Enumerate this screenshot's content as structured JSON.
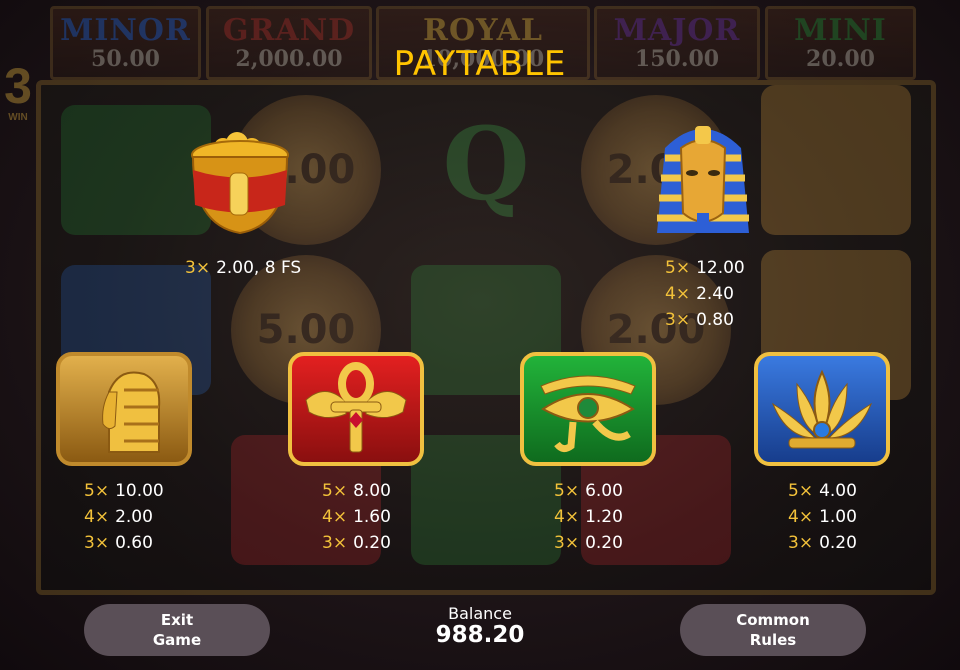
{
  "jackpots": [
    {
      "name": "MINOR",
      "value": "50.00",
      "color": "#2f6fe0"
    },
    {
      "name": "GRAND",
      "value": "2,000.00",
      "color": "#c0392b"
    },
    {
      "name": "ROYAL",
      "value": "10,000.00",
      "color": "#f0c040"
    },
    {
      "name": "MAJOR",
      "value": "150.00",
      "color": "#7a3ab0"
    },
    {
      "name": "MINI",
      "value": "20.00",
      "color": "#2f9a3a"
    }
  ],
  "background": {
    "side_digit": "3",
    "side_label": "WIN",
    "coin_values": [
      "3.00",
      "2.00",
      "5.00",
      "2.00"
    ],
    "letter_symbol": "Q"
  },
  "title": "PAYTABLE",
  "symbols": {
    "pot": {
      "icon": "gold-pot-icon",
      "pays": [
        {
          "mult": "3×",
          "value": "2.00, 8 FS"
        }
      ]
    },
    "pharaoh": {
      "icon": "pharaoh-mask-icon",
      "pays": [
        {
          "mult": "5×",
          "value": "12.00"
        },
        {
          "mult": "4×",
          "value": "2.40"
        },
        {
          "mult": "3×",
          "value": "0.80"
        }
      ]
    },
    "cleopatra": {
      "icon": "cleopatra-head-icon",
      "pays": [
        {
          "mult": "5×",
          "value": "10.00"
        },
        {
          "mult": "4×",
          "value": "2.00"
        },
        {
          "mult": "3×",
          "value": "0.60"
        }
      ]
    },
    "ankh": {
      "icon": "ankh-icon",
      "pays": [
        {
          "mult": "5×",
          "value": "8.00"
        },
        {
          "mult": "4×",
          "value": "1.60"
        },
        {
          "mult": "3×",
          "value": "0.20"
        }
      ]
    },
    "eye": {
      "icon": "eye-of-horus-icon",
      "pays": [
        {
          "mult": "5×",
          "value": "6.00"
        },
        {
          "mult": "4×",
          "value": "1.20"
        },
        {
          "mult": "3×",
          "value": "0.20"
        }
      ]
    },
    "lotus": {
      "icon": "lotus-icon",
      "pays": [
        {
          "mult": "5×",
          "value": "4.00"
        },
        {
          "mult": "4×",
          "value": "1.00"
        },
        {
          "mult": "3×",
          "value": "0.20"
        }
      ]
    }
  },
  "footer": {
    "exit_line1": "Exit",
    "exit_line2": "Game",
    "balance_label": "Balance",
    "balance_value": "988.20",
    "rules_line1": "Common",
    "rules_line2": "Rules"
  },
  "colors": {
    "accent": "#ffc400",
    "multiplier": "#f3c23a",
    "button": "#5a4f57"
  }
}
